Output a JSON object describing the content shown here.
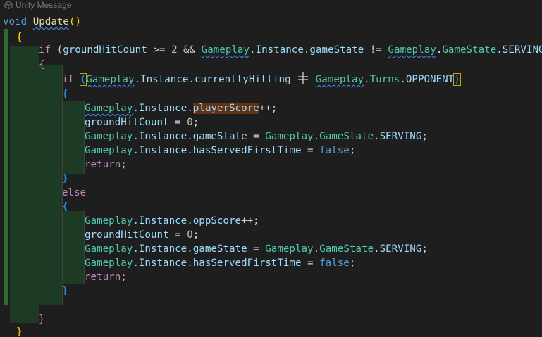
{
  "codelens": {
    "text": "Unity Message",
    "icon": "unity-icon"
  },
  "colors": {
    "background": "#1e1e1e",
    "keyword": "#569cd6",
    "type": "#4ec9b0",
    "member": "#9cdcfe"
  },
  "code": {
    "l1": {
      "kw": "void",
      "fn": "Update",
      "parens": "()"
    },
    "l2": {
      "open": "{"
    },
    "l3": {
      "if": "if",
      "pre": " (",
      "var": "groundHitCount",
      "mid": " >= ",
      "num": "2",
      "and": " && ",
      "cls1": "Gameplay",
      "mem1": ".Instance.gameState",
      "ne": " != ",
      "cls2": "Gameplay",
      "dot": ".",
      "type": "GameState",
      "dot2": ".",
      "enum": "SERVING",
      "close": ")"
    },
    "l4": {
      "open": "{"
    },
    "l5": {
      "if": "if",
      "sp": " ",
      "open": "(",
      "cls1": "Gameplay",
      "mem1": ".Instance.currentlyHitting",
      "sp2": " ",
      "sp3": " ",
      "cls2": "Gameplay",
      "dot": ".",
      "type": "Turns",
      "dot2": ".",
      "enum": "OPPONENT",
      "close": ")"
    },
    "l6": {
      "open": "{"
    },
    "l7": {
      "cls": "Gameplay",
      "mid": ".Instance.",
      "mem": "playerScore",
      "op": "++;"
    },
    "l8": {
      "var": "groundHitCount",
      "op": " = ",
      "num": "0",
      "semi": ";"
    },
    "l9": {
      "cls": "Gameplay",
      "mem": ".Instance.gameState",
      "op": " = ",
      "cls2": "Gameplay",
      "dot": ".",
      "type": "GameState",
      "dot2": ".",
      "enum": "SERVING",
      "semi": ";"
    },
    "l10": {
      "cls": "Gameplay",
      "mem": ".Instance.hasServedFirstTime",
      "op": " = ",
      "kw": "false",
      "semi": ";"
    },
    "l11": {
      "kw": "return",
      "semi": ";"
    },
    "l12": {
      "close": "}"
    },
    "l13": {
      "kw": "else"
    },
    "l14": {
      "open": "{"
    },
    "l15": {
      "cls": "Gameplay",
      "mem": ".Instance.oppScore",
      "op": "++;"
    },
    "l16": {
      "var": "groundHitCount",
      "op": " = ",
      "num": "0",
      "semi": ";"
    },
    "l17": {
      "cls": "Gameplay",
      "mem": ".Instance.gameState",
      "op": " = ",
      "cls2": "Gameplay",
      "dot": ".",
      "type": "GameState",
      "dot2": ".",
      "enum": "SERVING",
      "semi": ";"
    },
    "l18": {
      "cls": "Gameplay",
      "mem": ".Instance.hasServedFirstTime",
      "op": " = ",
      "kw": "false",
      "semi": ";"
    },
    "l19": {
      "kw": "return",
      "semi": ";"
    },
    "l20": {
      "close": "}"
    },
    "l22": {
      "close": "}"
    },
    "l23": {
      "close": "}"
    }
  }
}
